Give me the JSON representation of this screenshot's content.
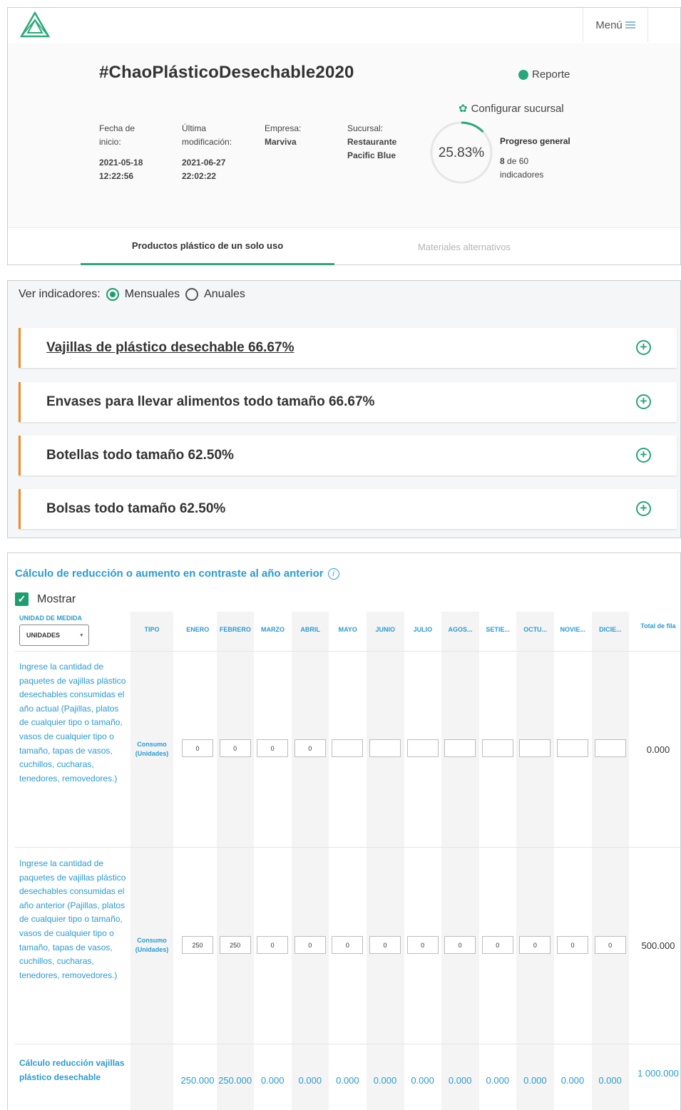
{
  "nav": {
    "menu_label": "Menú"
  },
  "header": {
    "title": "#ChaoPlásticoDesechable2020",
    "report_label": "Reporte",
    "config_label": "Configurar sucursal",
    "start_label": "Fecha de inicio:",
    "start_date": "2021-05-18",
    "start_time": "12:22:56",
    "modified_label": "Última modificación:",
    "modified_date": "2021-06-27",
    "modified_time": "22:02:22",
    "company_label": "Empresa:",
    "company": "Marviva",
    "branch_label": "Sucursal:",
    "branch": "Restaurante Pacific Blue",
    "progress_value": "25.83%",
    "progress_fraction": 0.2583,
    "progress_title": "Progreso general",
    "progress_count": "8",
    "progress_of": "de 60 indicadores"
  },
  "tabs": [
    {
      "label": "Productos plástico de un solo uso",
      "active": true
    },
    {
      "label": "Materiales alternativos",
      "active": false
    }
  ],
  "indicators": {
    "label": "Ver indicadores:",
    "option_monthly": "Mensuales",
    "option_yearly": "Anuales",
    "selected": "Mensuales",
    "items": [
      {
        "label": "Vajillas de plástico desechable 66.67%"
      },
      {
        "label": "Envases para llevar alimentos todo tamaño 66.67%"
      },
      {
        "label": "Botellas todo tamaño 62.50%"
      },
      {
        "label": "Bolsas todo tamaño 62.50%"
      }
    ]
  },
  "calc": {
    "title": "Cálculo de reducción o aumento en contraste al año anterior",
    "show_label": "Mostrar",
    "unit_label": "UNIDAD DE MEDIDA",
    "unit_value": "UNIDADES",
    "columns": {
      "tipo": "TIPO",
      "months": [
        "ENERO",
        "FEBRERO",
        "MARZO",
        "ABRIL",
        "MAYO",
        "JUNIO",
        "JULIO",
        "AGOS...",
        "SETIE...",
        "OCTU...",
        "NOVIE...",
        "DICIE..."
      ],
      "total": "Total de fila"
    },
    "rows": [
      {
        "description": "Ingrese la cantidad de paquetes de vajillas plástico desechables consumidas el año actual (Pajillas, platos de cualquier tipo o tamaño, vasos de cualquier tipo o tamaño, tapas de vasos, cuchillos, cucharas, tenedores, removedores.)",
        "tipo": "Consumo (Unidades)",
        "values": [
          "0",
          "0",
          "0",
          "0",
          "",
          "",
          "",
          "",
          "",
          "",
          "",
          ""
        ],
        "total": "0.000"
      },
      {
        "description": "Ingrese la cantidad de paquetes de vajillas plástico desechables consumidas el año anterior (Pajillas, platos de cualquier tipo o tamaño, vasos de cualquier tipo o tamaño, tapas de vasos, cuchillos, cucharas, tenedores, removedores.)",
        "tipo": "Consumo (Unidades)",
        "values": [
          "250",
          "250",
          "0",
          "0",
          "0",
          "0",
          "0",
          "0",
          "0",
          "0",
          "0",
          "0"
        ],
        "total": "500.000"
      }
    ],
    "result": {
      "label": "Cálculo reducción vajillas plástico desechable",
      "values": [
        "250.000",
        "250.000",
        "0.000",
        "0.000",
        "0.000",
        "0.000",
        "0.000",
        "0.000",
        "0.000",
        "0.000",
        "0.000",
        "0.000"
      ],
      "total": "1 000.000"
    }
  },
  "colors": {
    "accent_green": "#1f9d6e",
    "accent_blue": "#2a9bd1",
    "card_border": "#f28c28"
  }
}
